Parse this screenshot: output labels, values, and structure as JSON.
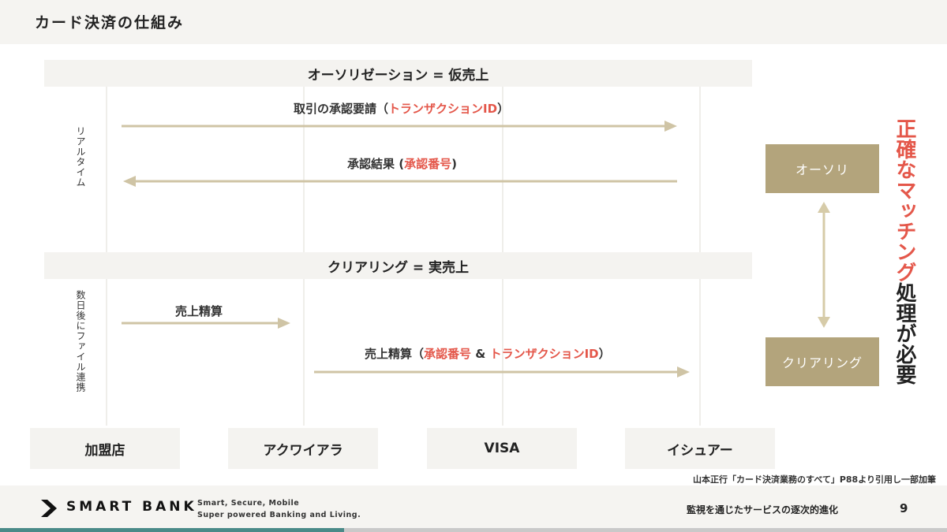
{
  "header": {
    "title": "カード決済の仕組み"
  },
  "authorization": {
    "band_label": "オーソリゼーション = 仮売上",
    "side_label": "リアルタイム",
    "request": {
      "prefix": "取引の承認要請（",
      "highlight": "トランザクションID",
      "suffix": "）"
    },
    "result": {
      "prefix": "承認結果 (",
      "highlight": "承認番号",
      "suffix": ")"
    }
  },
  "clearing": {
    "band_label": "クリアリング = 実売上",
    "side_label": "数日後にファイル連携",
    "settlement1": {
      "label": "売上精算"
    },
    "settlement2": {
      "prefix": "売上精算（",
      "highlight1": "承認番号",
      "middle": " & ",
      "highlight2": "トランザクションID",
      "suffix": "）"
    }
  },
  "parties": [
    "加盟店",
    "アクワイアラ",
    "VISA",
    "イシュアー"
  ],
  "matching": {
    "box_top": "オーソリ",
    "box_bottom": "クリアリング",
    "text_highlight": "正確なマッチング",
    "text_rest": "処理が必要"
  },
  "source_note": "山本正行「カード決済業務のすべて」P88より引用し一部加筆",
  "footer": {
    "brand": "SMART BANK",
    "tagline1": "Smart, Secure, Mobile",
    "tagline2": "Super powered Banking and Living.",
    "right_text": "監視を通じたサービスの逐次的進化",
    "page_number": "9"
  },
  "colors": {
    "accent_red": "#e4574a",
    "gold": "#b3a47c",
    "teal": "#4a8a88",
    "panel": "#f4f3f0"
  }
}
